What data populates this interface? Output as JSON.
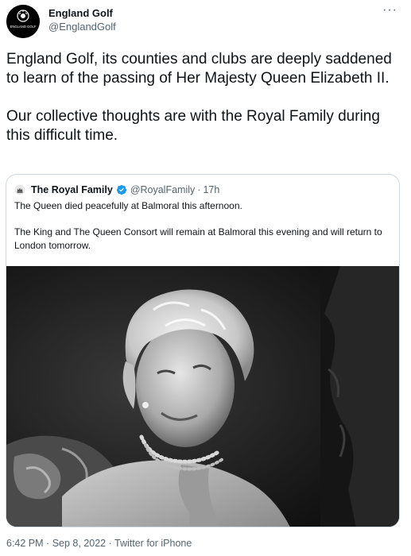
{
  "author": {
    "name": "England Golf",
    "handle": "@EnglandGolf",
    "avatar_icon": "england-golf-logo",
    "avatar_text": "ENGLAND GOLF"
  },
  "more_icon": "···",
  "tweet": {
    "paragraphs": [
      "England Golf, its counties and clubs are deeply saddened to learn of the passing of Her Majesty Queen Elizabeth II.",
      "Our collective thoughts are with the Royal Family during this difficult time."
    ]
  },
  "quote": {
    "name": "The Royal Family",
    "handle": "@RoyalFamily",
    "separator": "·",
    "time": "17h",
    "avatar_icon": "royal-crest-icon",
    "verified_icon": "verified-badge-icon",
    "paragraphs": [
      "The Queen died peacefully at Balmoral this afternoon.",
      "The King and The Queen Consort will remain at Balmoral this evening and will return to London tomorrow."
    ]
  },
  "meta": {
    "time": "6:42 PM",
    "date": "Sep 8, 2022",
    "source": "Twitter for iPhone",
    "separator": "·"
  },
  "colors": {
    "text": "#0f1419",
    "secondary": "#536471",
    "verified": "#1d9bf0",
    "border": "#cfd9de"
  }
}
